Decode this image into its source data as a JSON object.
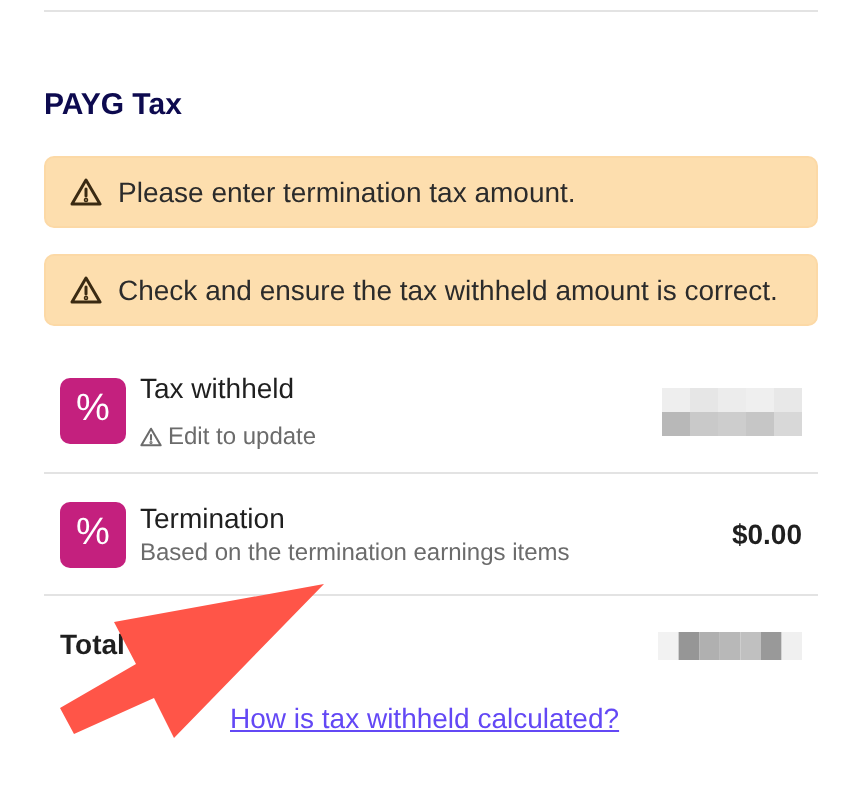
{
  "section": {
    "title": "PAYG Tax"
  },
  "alerts": [
    "Please enter termination tax amount.",
    "Check and ensure the tax withheld amount is correct."
  ],
  "items": [
    {
      "icon": "%",
      "title": "Tax withheld",
      "subtitle": "Edit to update",
      "subtitle_warning": true,
      "redacted": true
    },
    {
      "icon": "%",
      "title": "Termination",
      "subtitle": "Based on the termination earnings items",
      "subtitle_warning": false,
      "redacted": false,
      "value": "$0.00"
    }
  ],
  "total": {
    "label": "Total",
    "redacted": true
  },
  "link": "How is tax withheld calculated?",
  "annotation": {
    "kind": "arrow"
  }
}
